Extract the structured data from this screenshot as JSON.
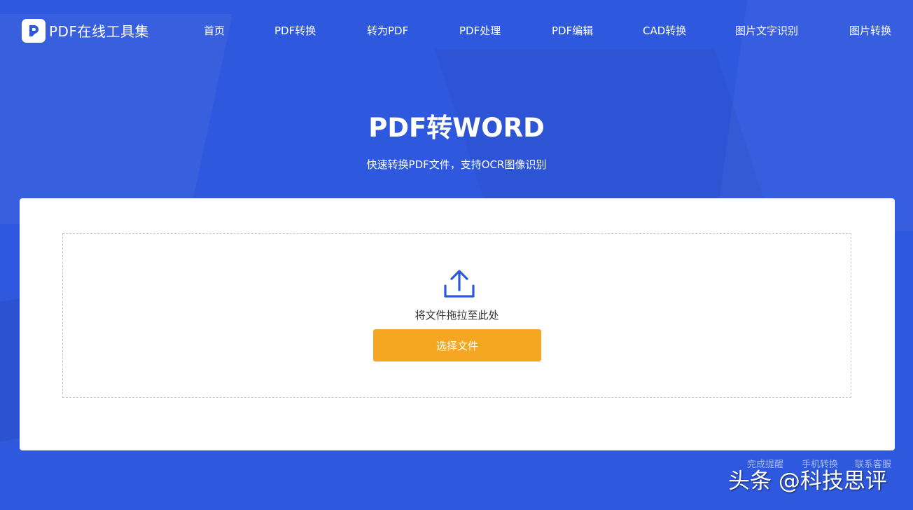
{
  "header": {
    "logo_text": "PDF在线工具集",
    "logo_icon": "pdf-logo-icon",
    "nav": [
      {
        "label": "首页"
      },
      {
        "label": "PDF转换"
      },
      {
        "label": "转为PDF"
      },
      {
        "label": "PDF处理"
      },
      {
        "label": "PDF编辑"
      },
      {
        "label": "CAD转换"
      },
      {
        "label": "图片文字识别"
      },
      {
        "label": "图片转换"
      }
    ]
  },
  "hero": {
    "title": "PDF转WORD",
    "subtitle": "快速转换PDF文件，支持OCR图像识别"
  },
  "upload": {
    "icon": "upload-icon",
    "drop_text": "将文件拖拉至此处",
    "button_label": "选择文件"
  },
  "footer": {
    "links": [
      {
        "label": "完成提醒"
      },
      {
        "label": "手机转换"
      },
      {
        "label": "联系客服"
      }
    ]
  },
  "watermark": "头条 @科技思评",
  "colors": {
    "background": "#2e58dd",
    "card": "#ffffff",
    "button": "#f5a623",
    "icon_blue": "#2d5bd6"
  }
}
